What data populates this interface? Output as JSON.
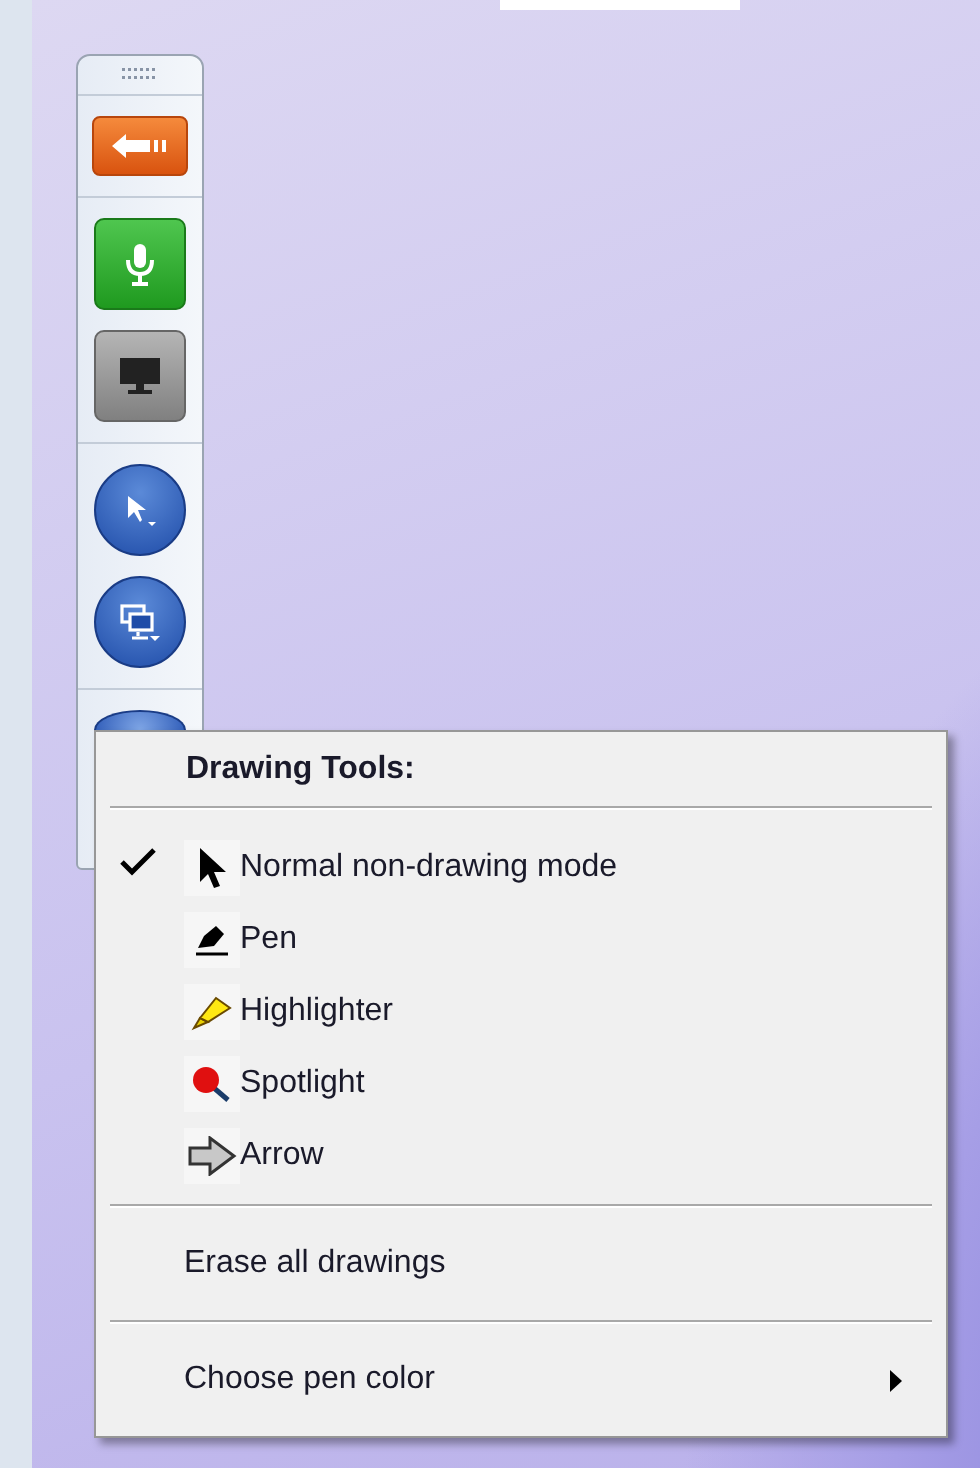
{
  "toolbar": {
    "buttons": [
      {
        "kind": "back"
      },
      {
        "kind": "microphone"
      },
      {
        "kind": "screen"
      },
      {
        "kind": "pointer"
      },
      {
        "kind": "displays"
      },
      {
        "kind": "partial"
      }
    ]
  },
  "menu": {
    "title": "Drawing Tools:",
    "tools": [
      {
        "kind": "cursor",
        "label": "Normal non-drawing mode",
        "selected": true
      },
      {
        "kind": "pen",
        "label": "Pen",
        "selected": false
      },
      {
        "kind": "highlighter",
        "label": "Highlighter",
        "selected": false
      },
      {
        "kind": "spotlight",
        "label": "Spotlight",
        "selected": false
      },
      {
        "kind": "arrow",
        "label": "Arrow",
        "selected": false
      }
    ],
    "actions": [
      {
        "label": "Erase all drawings",
        "submenu": false
      },
      {
        "label": "Choose pen color",
        "submenu": true
      }
    ]
  }
}
